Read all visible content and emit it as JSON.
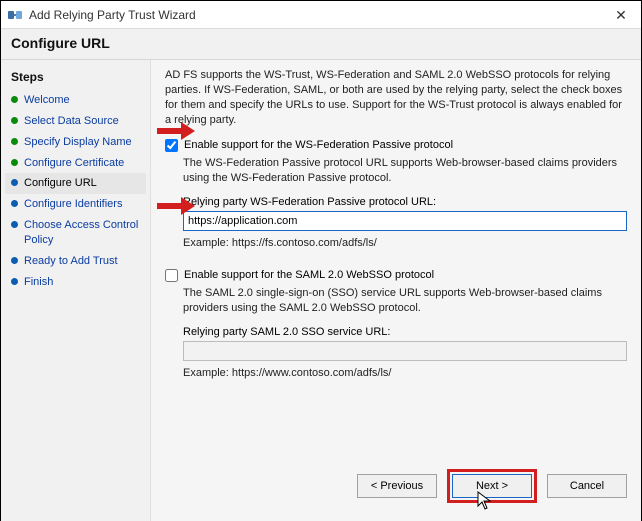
{
  "window": {
    "title": "Add Relying Party Trust Wizard",
    "close_label": "✕"
  },
  "header": {
    "title": "Configure URL"
  },
  "sidebar": {
    "title": "Steps",
    "items": [
      {
        "label": "Welcome",
        "state": "done"
      },
      {
        "label": "Select Data Source",
        "state": "done"
      },
      {
        "label": "Specify Display Name",
        "state": "done"
      },
      {
        "label": "Configure Certificate",
        "state": "done"
      },
      {
        "label": "Configure URL",
        "state": "current"
      },
      {
        "label": "Configure Identifiers",
        "state": "todo"
      },
      {
        "label": "Choose Access Control Policy",
        "state": "todo"
      },
      {
        "label": "Ready to Add Trust",
        "state": "todo"
      },
      {
        "label": "Finish",
        "state": "todo"
      }
    ]
  },
  "main": {
    "intro": "AD FS supports the WS-Trust, WS-Federation and SAML 2.0 WebSSO protocols for relying parties.  If WS-Federation, SAML, or both are used by the relying party, select the check boxes for them and specify the URLs to use.  Support for the WS-Trust protocol is always enabled for a relying party.",
    "wsfed": {
      "checkbox_label": "Enable support for the WS-Federation Passive protocol",
      "checked": true,
      "desc": "The WS-Federation Passive protocol URL supports Web-browser-based claims providers using the WS-Federation Passive protocol.",
      "url_label": "Relying party WS-Federation Passive protocol URL:",
      "url_value": "https://application.com",
      "example": "Example: https://fs.contoso.com/adfs/ls/"
    },
    "saml": {
      "checkbox_label": "Enable support for the SAML 2.0 WebSSO protocol",
      "checked": false,
      "desc": "The SAML 2.0 single-sign-on (SSO) service URL supports Web-browser-based claims providers using the SAML 2.0 WebSSO protocol.",
      "url_label": "Relying party SAML 2.0 SSO service URL:",
      "url_value": "",
      "example": "Example: https://www.contoso.com/adfs/ls/"
    }
  },
  "footer": {
    "previous": "< Previous",
    "next": "Next >",
    "cancel": "Cancel"
  }
}
